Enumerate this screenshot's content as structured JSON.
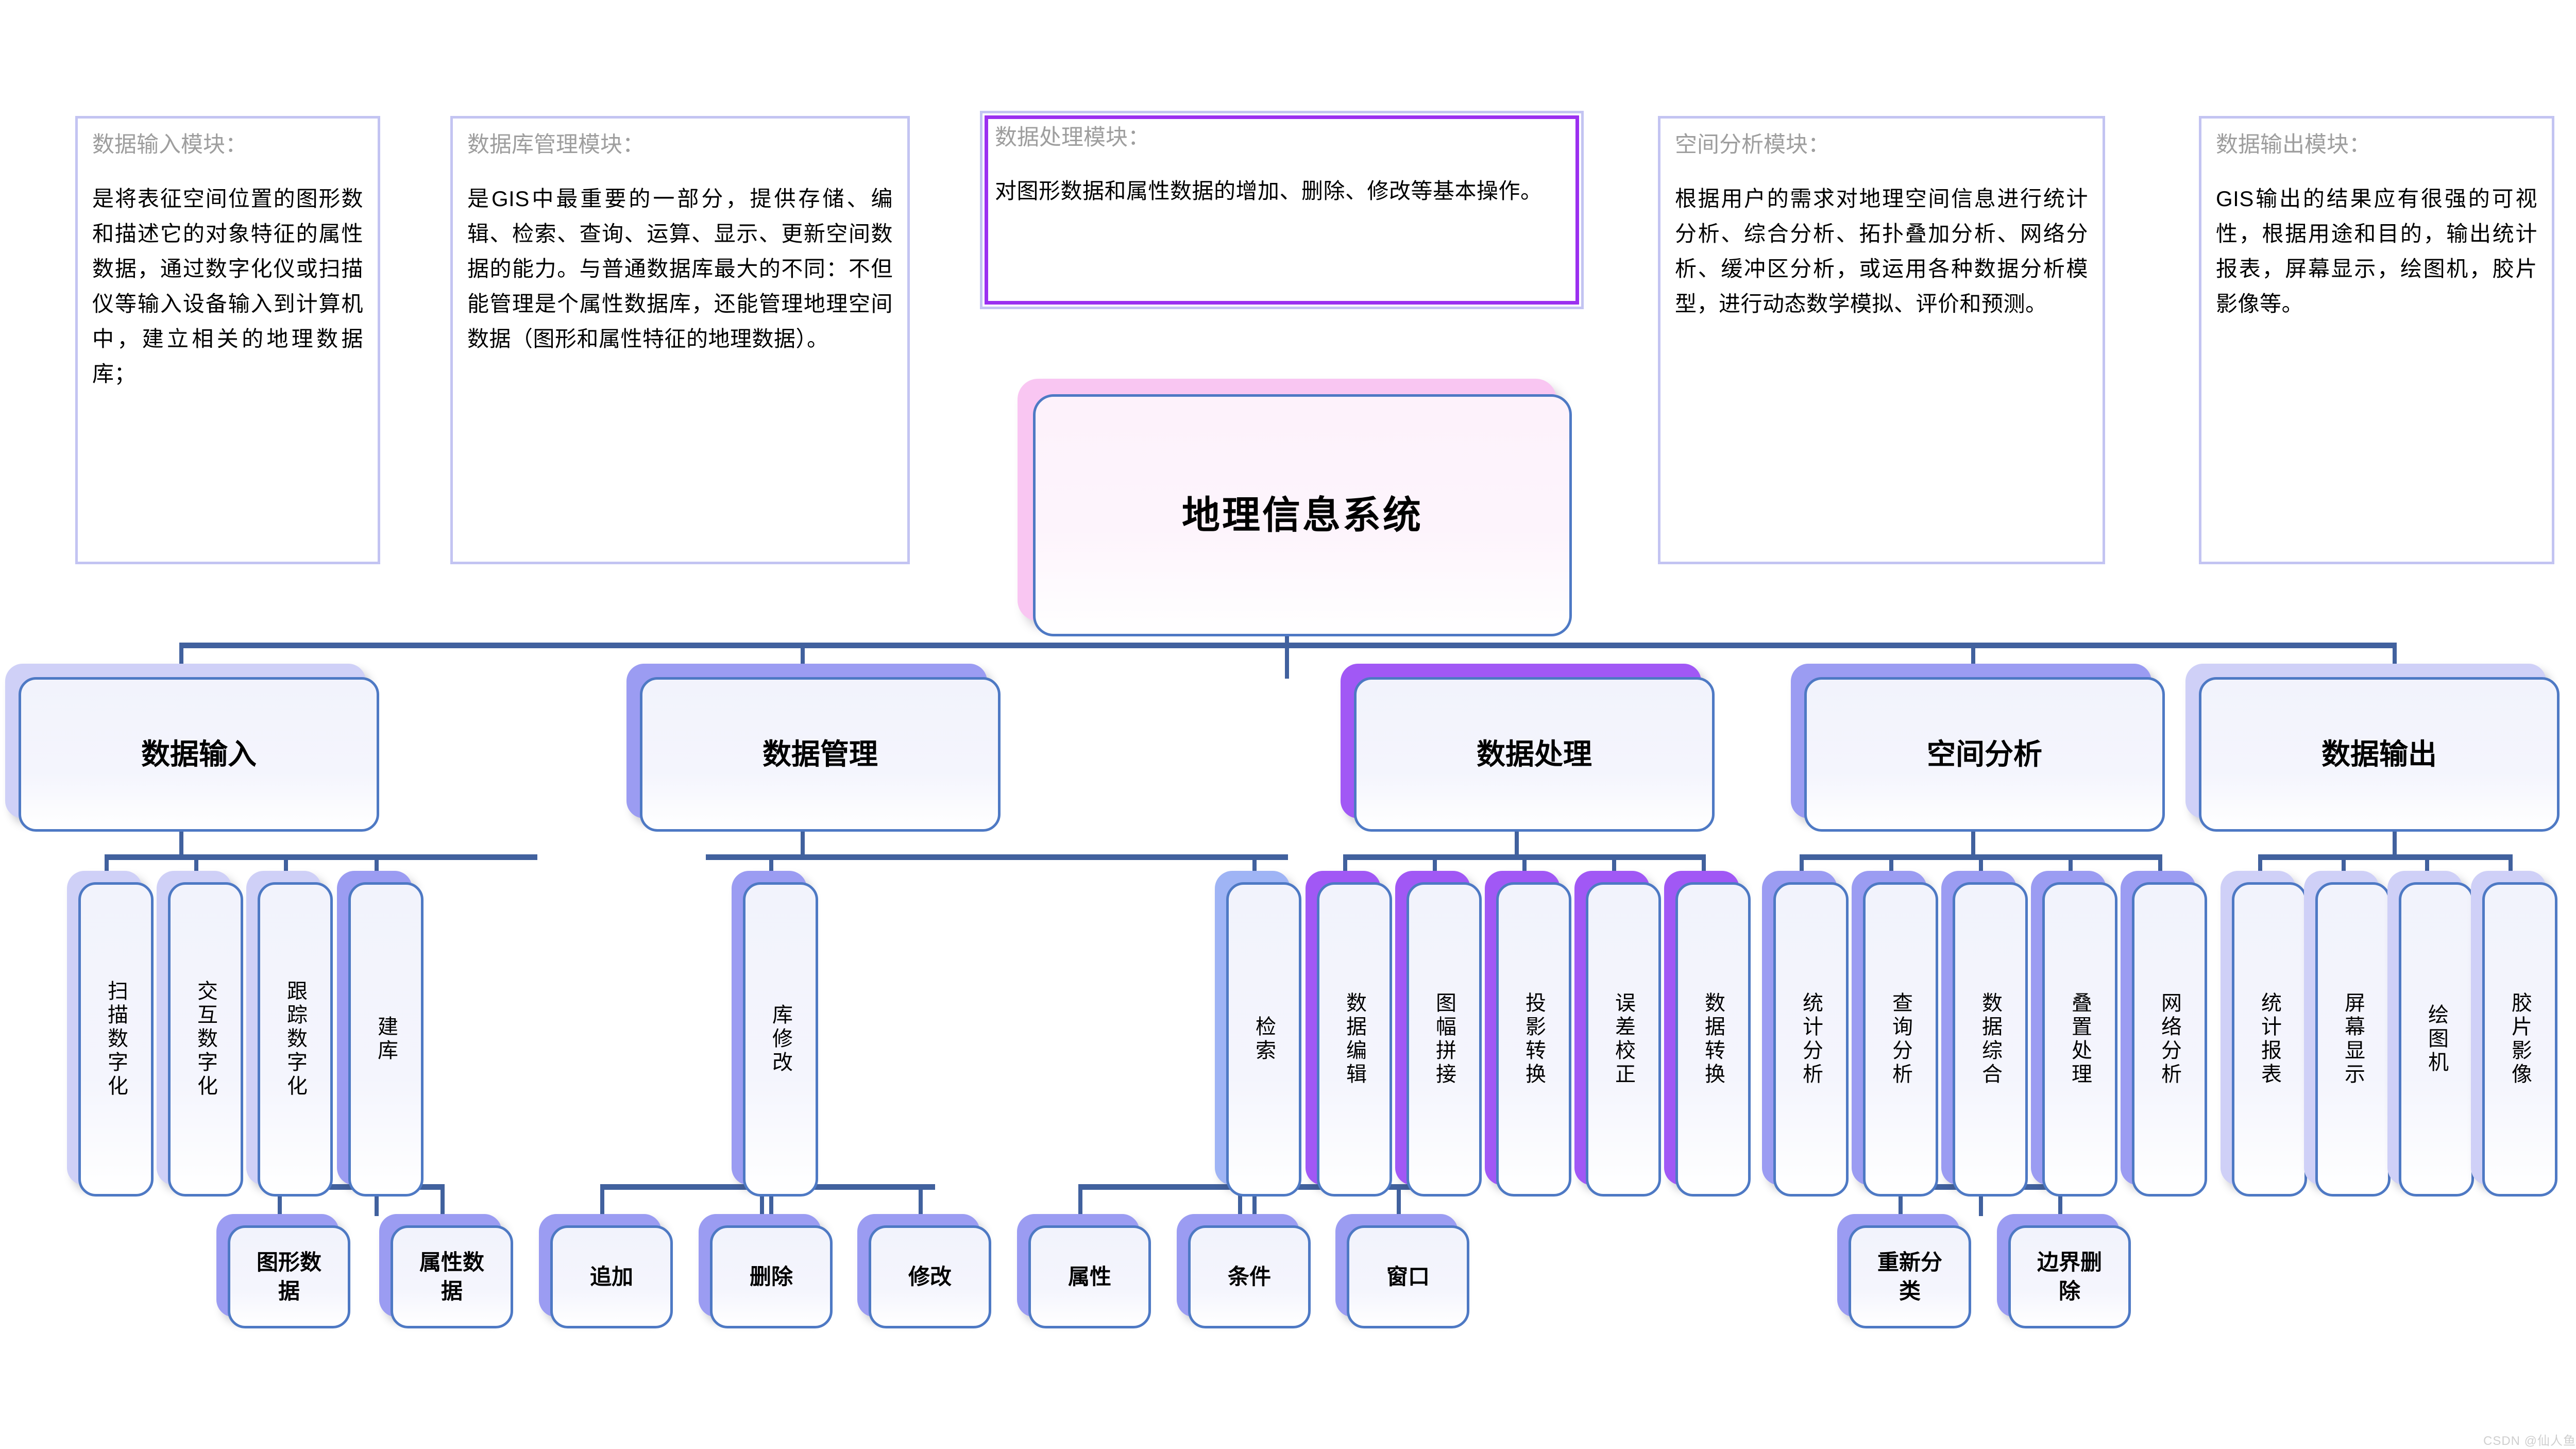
{
  "colors": {
    "desc_border": "#c3c4f2",
    "desc_accent_border": "#9b30f0",
    "node_border": "#4e79c4",
    "connector": "#41619e",
    "root_shadow": "#f9c6f2",
    "shadow_pale": "#cfd0f7",
    "shadow_mid": "#9b9cf2",
    "shadow_vivid": "#a158f5",
    "title_text": "#9e9e9e"
  },
  "descriptions": [
    {
      "id": "data-input-module",
      "title": "数据输入模块：",
      "body": "是将表征空间位置的图形数和描述它的对象特征的属性数据，通过数字化仪或扫描仪等输入设备输入到计算机中，建立相关的地理数据库；",
      "accent": false
    },
    {
      "id": "database-management-module",
      "title": "数据库管理模块：",
      "body": "是GIS中最重要的一部分，提供存储、编辑、检索、查询、运算、显示、更新空间数据的能力。与普通数据库最大的不同：不但能管理是个属性数据库，还能管理地理空间数据（图形和属性特征的地理数据）。",
      "accent": false
    },
    {
      "id": "data-processing-module",
      "title": "数据处理模块：",
      "body": "对图形数据和属性数据的增加、删除、修改等基本操作。",
      "accent": true
    },
    {
      "id": "spatial-analysis-module",
      "title": "空间分析模块：",
      "body": "根据用户的需求对地理空间信息进行统计分析、综合分析、拓扑叠加分析、网络分析、缓冲区分析，或运用各种数据分析模型，进行动态数学模拟、评价和预测。",
      "accent": false
    },
    {
      "id": "data-output-module",
      "title": "数据输出模块：",
      "body": "GIS输出的结果应有很强的可视性，根据用途和目的，输出统计报表，屏幕显示，绘图机，胶片影像等。",
      "accent": false
    }
  ],
  "root": {
    "label": "地理信息系统"
  },
  "level2": [
    {
      "id": "data-input",
      "label": "数据输入"
    },
    {
      "id": "data-management",
      "label": "数据管理"
    },
    {
      "id": "data-processing",
      "label": "数据处理"
    },
    {
      "id": "spatial-analysis",
      "label": "空间分析"
    },
    {
      "id": "data-output",
      "label": "数据输出"
    }
  ],
  "level3": [
    {
      "id": "scan-digitize",
      "label": "扫描数字化"
    },
    {
      "id": "interactive-digitize",
      "label": "交互数字化"
    },
    {
      "id": "trace-digitize",
      "label": "跟踪数字化"
    },
    {
      "id": "build-database",
      "label": "建库"
    },
    {
      "id": "library-modify",
      "label": "库修改"
    },
    {
      "id": "retrieval",
      "label": "检索"
    },
    {
      "id": "data-editing",
      "label": "数据编辑"
    },
    {
      "id": "sheet-mosaic",
      "label": "图幅拼接"
    },
    {
      "id": "projection-transform",
      "label": "投影转换"
    },
    {
      "id": "error-correction",
      "label": "误差校正"
    },
    {
      "id": "data-conversion",
      "label": "数据转换"
    },
    {
      "id": "statistical-analysis",
      "label": "统计分析"
    },
    {
      "id": "query-analysis",
      "label": "查询分析"
    },
    {
      "id": "data-generalization",
      "label": "数据综合"
    },
    {
      "id": "overlay-processing",
      "label": "叠置处理"
    },
    {
      "id": "network-analysis",
      "label": "网络分析"
    },
    {
      "id": "statistical-report",
      "label": "统计报表"
    },
    {
      "id": "screen-display",
      "label": "屏幕显示"
    },
    {
      "id": "plotter",
      "label": "绘图机"
    },
    {
      "id": "film-image",
      "label": "胶片影像"
    }
  ],
  "level4": [
    {
      "id": "graphic-data",
      "label": "图形数据"
    },
    {
      "id": "attribute-data",
      "label": "属性数据"
    },
    {
      "id": "append",
      "label": "追加"
    },
    {
      "id": "delete",
      "label": "删除"
    },
    {
      "id": "modify",
      "label": "修改"
    },
    {
      "id": "attribute",
      "label": "属性"
    },
    {
      "id": "condition",
      "label": "条件"
    },
    {
      "id": "window",
      "label": "窗口"
    },
    {
      "id": "reclassify",
      "label": "重新分类"
    },
    {
      "id": "boundary-delete",
      "label": "边界删除"
    }
  ],
  "watermark": {
    "text": "CSDN @仙人鱼"
  }
}
